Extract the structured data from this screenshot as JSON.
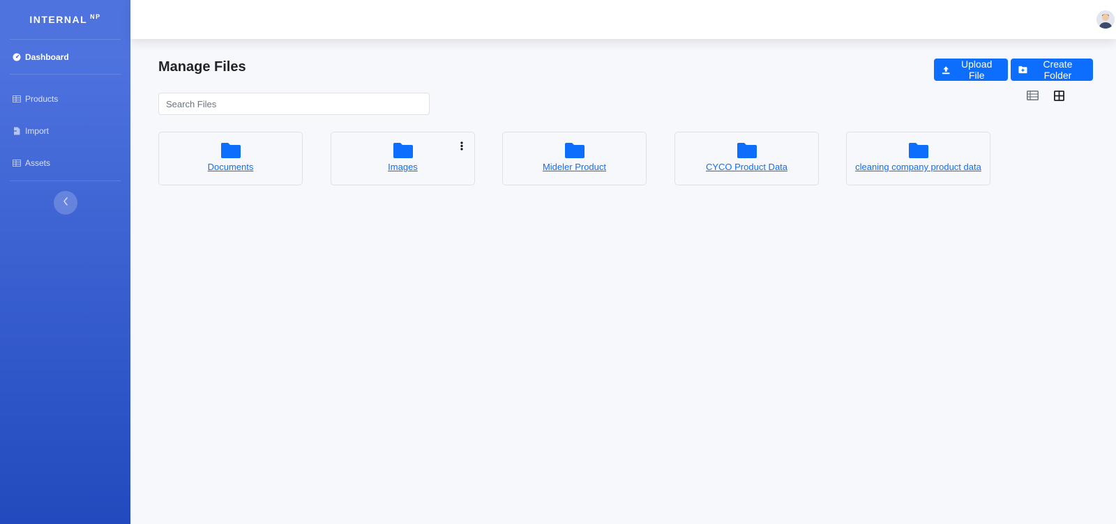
{
  "brand": {
    "name": "INTERNAL",
    "sup": "NP"
  },
  "sidebar": {
    "items": [
      {
        "label": "Dashboard",
        "icon": "dashboard-gauge-icon"
      },
      {
        "label": "Products",
        "icon": "table-icon"
      },
      {
        "label": "Import",
        "icon": "file-import-icon"
      },
      {
        "label": "Assets",
        "icon": "table-icon"
      }
    ],
    "toggle_icon": "chevron-left-icon"
  },
  "topbar": {
    "avatar_icon": "user-avatar"
  },
  "main": {
    "title": "Manage Files",
    "upload_label": "Upload File",
    "create_folder_label": "Create Folder",
    "search_placeholder": "Search Files",
    "view_icons": [
      "list-view-icon",
      "grid-view-icon"
    ],
    "folders": [
      {
        "name": "Documents"
      },
      {
        "name": "Images"
      },
      {
        "name": "Mideler Product"
      },
      {
        "name": "CYCO Product Data"
      },
      {
        "name": "cleaning company product data"
      }
    ]
  },
  "colors": {
    "primary": "#0d6efd",
    "sidebar_top": "#4e73df",
    "sidebar_bottom": "#224abe"
  }
}
